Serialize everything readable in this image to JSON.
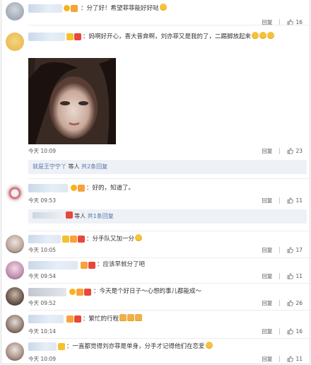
{
  "comments": [
    {
      "text": "分了好！希望菲菲能好好哒",
      "reply_label": "回复",
      "likes": "16"
    },
    {
      "text": "妈啊好开心，喜大普奔啊，刘亦菲又是我的了，二踢脚放起来",
      "time": "今天 10:09",
      "reply_label": "回复",
      "likes": "23",
      "sub_reply": {
        "prefix": "就是王宁宁丫",
        "suffix": " 等人",
        "link": "共2条回复"
      }
    },
    {
      "text": "好的，知道了。",
      "time": "今天 09:53",
      "reply_label": "回复",
      "likes": "11",
      "sub_reply": {
        "suffix": "等人",
        "link": "共1条回复"
      }
    },
    {
      "text": "分手队又加一分",
      "time": "今天 10:05",
      "reply_label": "回复",
      "likes": "17"
    },
    {
      "text": "应该早就分了吧",
      "time": "今天 09:54",
      "reply_label": "回复",
      "likes": "11"
    },
    {
      "text": "今天是个好日子～心想的事儿都能成～",
      "time": "今天 09:52",
      "reply_label": "回复",
      "likes": "26"
    },
    {
      "text": "繁忙的行程",
      "time": "今天 10:14",
      "reply_label": "回复",
      "likes": "16"
    },
    {
      "text": "一直都觉得刘亦菲是单身，分手才记得他们在恋爱",
      "time": "今天 10:09",
      "reply_label": "回复",
      "likes": "11"
    }
  ],
  "colors": {
    "link": "#5174a8",
    "reply_bg": "#eef1f6",
    "badge_orange": "#f7a23a",
    "badge_red": "#e8473b"
  },
  "icons": [
    "thumbs-up-icon",
    "vip-badge-icon",
    "emoji-icon"
  ]
}
